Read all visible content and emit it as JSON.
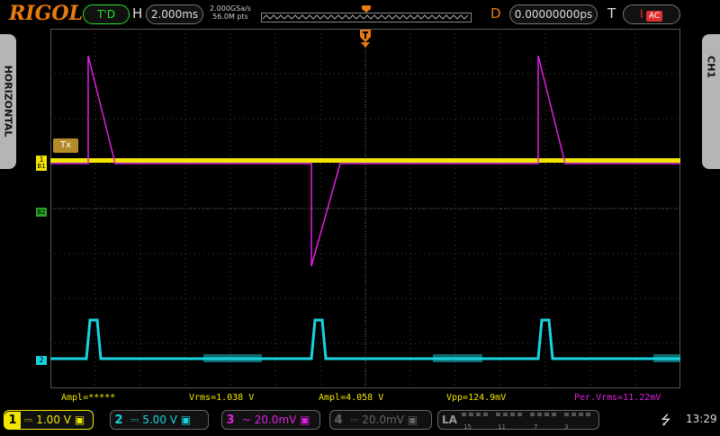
{
  "brand": "RIGOL",
  "trigger_status": "T'D",
  "horizontal": {
    "label": "H",
    "timebase": "2.000ms",
    "sample_rate": "2.000GSa/s",
    "memory_depth": "56.0M pts"
  },
  "delay": {
    "label": "D",
    "value": "0.00000000ps"
  },
  "trigger": {
    "label": "T",
    "source_badge": "AC"
  },
  "side_tabs": {
    "left": "HORIZONTAL",
    "right": "CH1"
  },
  "channel_markers": {
    "ch1": "1",
    "ch2": "2",
    "b1": "B1",
    "b2": "B2",
    "tx_label": "Tx"
  },
  "measurements": [
    {
      "text": "Ampl=*****",
      "color": "#f2e600"
    },
    {
      "text": "Vrms=1.038 V",
      "color": "#f2e600"
    },
    {
      "text": "Ampl=4.058 V",
      "color": "#f2e600"
    },
    {
      "text": "Vpp=124.9mV",
      "color": "#f2e600"
    },
    {
      "text": "Per.Vrms=11.22mV",
      "color": "#e020e0"
    }
  ],
  "channels": [
    {
      "num": "1",
      "coupling": "⎓",
      "scale": "1.00 V",
      "color": "#f2e600"
    },
    {
      "num": "2",
      "coupling": "⎓",
      "scale": "5.00 V",
      "color": "#19d3e0"
    },
    {
      "num": "3",
      "coupling": "~",
      "scale": "20.0mV",
      "color": "#e020e0"
    },
    {
      "num": "4",
      "coupling": "⎓",
      "scale": "20.0mV",
      "color": "#666666"
    }
  ],
  "la": {
    "label": "LA",
    "groups": [
      "15",
      "11",
      "7",
      "3"
    ]
  },
  "clock": "13:29",
  "colors": {
    "ch1": "#f2e600",
    "ch2": "#19d3e0",
    "ch3": "#e020e0",
    "trigger": "#e87b0f",
    "grid": "#444444"
  }
}
